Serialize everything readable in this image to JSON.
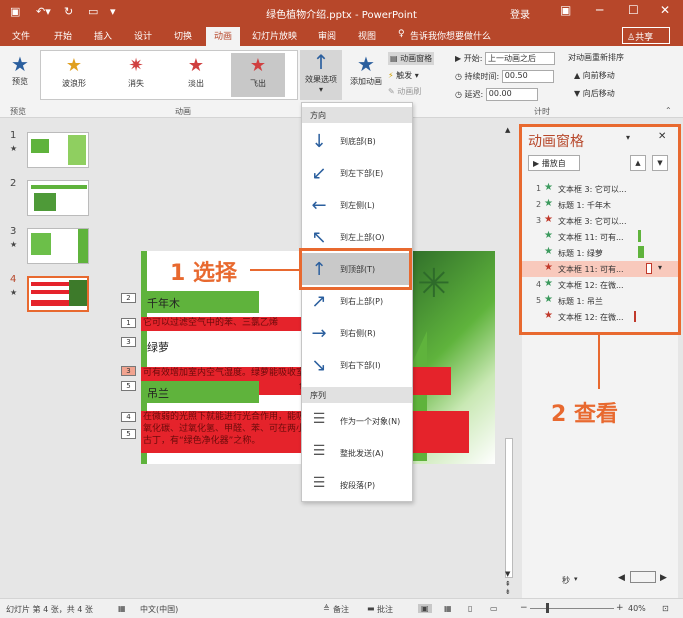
{
  "titlebar": {
    "title": "绿色植物介绍.pptx - PowerPoint",
    "login": "登录"
  },
  "tabs": [
    "文件",
    "开始",
    "插入",
    "设计",
    "切换",
    "动画",
    "幻灯片放映",
    "审阅",
    "视图"
  ],
  "tell_me": "告诉我你想要做什么",
  "share": "共享",
  "ribbon": {
    "preview": "预览",
    "preview_group": "预览",
    "animation_group": "动画",
    "gallery": [
      "波浪形",
      "消失",
      "淡出",
      "飞出"
    ],
    "effect_options": "效果选项",
    "add_animation": "添加动画",
    "animation_pane": "动画窗格",
    "trigger": "触发",
    "animation_painter": "动画刷",
    "start_label": "开始:",
    "start_value": "上一动画之后",
    "duration_label": "持续时间:",
    "duration_value": "00.50",
    "delay_label": "延迟:",
    "delay_value": "00.00",
    "reorder_title": "对动画重新排序",
    "move_earlier": "向前移动",
    "move_later": "向后移动",
    "timing_group": "计时"
  },
  "thumbs": [
    {
      "num": "1",
      "star": "★"
    },
    {
      "num": "2",
      "star": ""
    },
    {
      "num": "3",
      "star": "★"
    },
    {
      "num": "4",
      "star": "★"
    }
  ],
  "slide": {
    "title1": "千年木",
    "red1": "它可以过滤空气中的苯、三氯乙烯",
    "title2": "绿萝",
    "red2": "可有效增加室内空气湿度。绿萝能吸收室内",
    "red2b": "色，对吸收甲醛的能力。",
    "title3": "吊兰",
    "red3": "在微弱的光照下就能进行光合作用，能吸收一些毒气，如：一",
    "red3b": "氧化碳、过氧化氢、甲醛、苯、可在两小时内将宇宙飞船中的尼",
    "red3c": "古丁，有“绿色净化器”之称。",
    "tags": [
      "2",
      "1",
      "3",
      "3",
      "5",
      "4",
      "5"
    ]
  },
  "dropdown": {
    "direction": "方向",
    "items": [
      "到底部(B)",
      "到左下部(E)",
      "到左侧(L)",
      "到左上部(O)",
      "到顶部(T)",
      "到右上部(P)",
      "到右侧(R)",
      "到右下部(I)"
    ],
    "sequence": "序列",
    "seq_items": [
      "作为一个对象(N)",
      "整批发送(A)",
      "按段落(P)"
    ]
  },
  "annotations": {
    "select": "1 选择",
    "view": "2 查看"
  },
  "pane": {
    "title": "动画窗格",
    "play": "播放自",
    "items": [
      {
        "n": "1",
        "star_color": "#3c9a5e",
        "text": "文本框 3: 它可以..."
      },
      {
        "n": "2",
        "star_color": "#3c9a5e",
        "text": "标题 1: 千年木"
      },
      {
        "n": "3",
        "star_color": "#c0392b",
        "text": "文本框 3: 它可以..."
      },
      {
        "n": "",
        "star_color": "#3c9a5e",
        "text": "文本框 11: 可有..."
      },
      {
        "n": "",
        "star_color": "#3c9a5e",
        "text": "标题 1: 绿萝"
      },
      {
        "n": "",
        "star_color": "#c0392b",
        "text": "文本框 11: 可有..."
      },
      {
        "n": "4",
        "star_color": "#3c9a5e",
        "text": "文本框 12: 在微..."
      },
      {
        "n": "5",
        "star_color": "#3c9a5e",
        "text": "标题 1: 吊兰"
      },
      {
        "n": "",
        "star_color": "#c0392b",
        "text": "文本框 12: 在微..."
      }
    ],
    "seconds": "秒"
  },
  "status": {
    "slide_info": "幻灯片 第 4 张，共 4 张",
    "language": "中文(中国)",
    "notes": "备注",
    "comments": "批注",
    "zoom": "40%"
  },
  "colors": {
    "accent": "#b7472a",
    "highlight": "#e8692f"
  }
}
